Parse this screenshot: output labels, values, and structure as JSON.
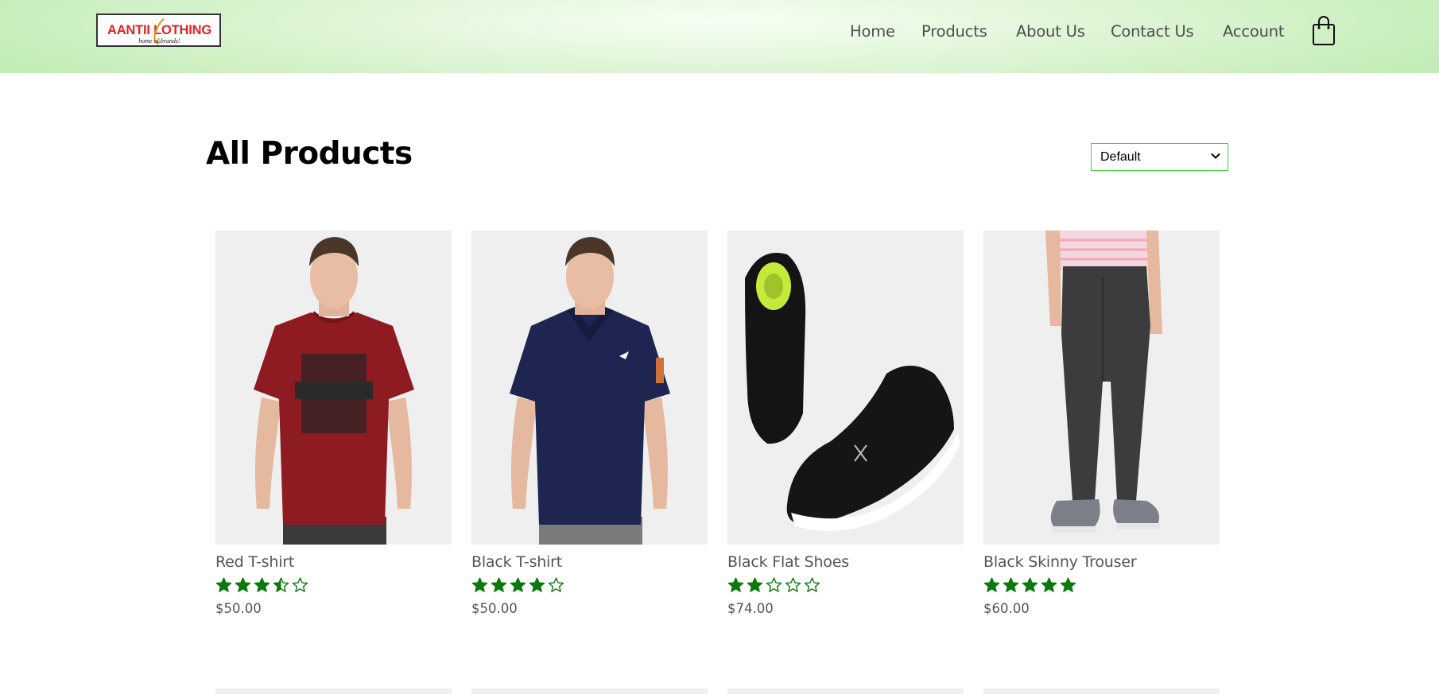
{
  "brand": {
    "logo_text": "AANTII LOTHING",
    "tagline": "home of brands!",
    "accent": "#e02424"
  },
  "nav": {
    "items": [
      "Home",
      "Products",
      "About Us",
      "Contact Us",
      "Account"
    ],
    "cart_icon": "shopping-bag-icon"
  },
  "page": {
    "title": "All Products"
  },
  "sort": {
    "selected": "Default"
  },
  "products": [
    {
      "name": "Red T-shirt",
      "rating": 3.5,
      "price": "$50.00"
    },
    {
      "name": "Black T-shirt",
      "rating": 4,
      "price": "$50.00"
    },
    {
      "name": "Black Flat Shoes",
      "rating": 2,
      "price": "$74.00"
    },
    {
      "name": "Black Skinny Trouser",
      "rating": 5,
      "price": "$60.00"
    }
  ],
  "colors": {
    "star": "#0a7a0a",
    "select_border": "#3fd33f",
    "header_green": "#c3ecb6"
  }
}
